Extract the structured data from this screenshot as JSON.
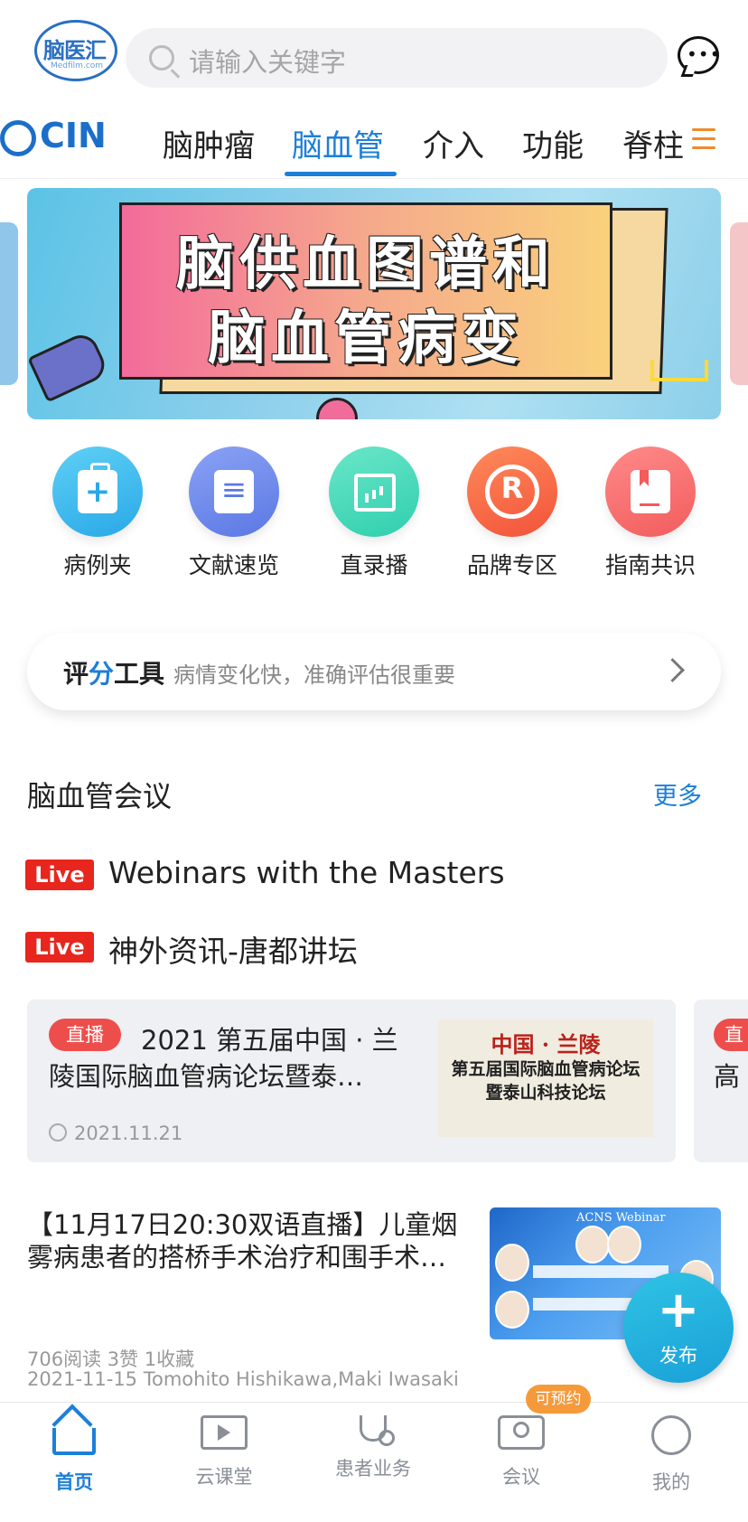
{
  "header": {
    "logo_text": "脑医汇",
    "logo_sub": "Medfilm.com",
    "search_placeholder": "请输入关键字"
  },
  "tabs": {
    "brand": "CIN",
    "items": [
      {
        "label": "脑肿瘤"
      },
      {
        "label": "脑血管",
        "active": true
      },
      {
        "label": "介入"
      },
      {
        "label": "功能"
      },
      {
        "label": "脊柱"
      }
    ]
  },
  "banner": {
    "line1": "脑供血图谱和",
    "line2": "脑血管病变"
  },
  "quick_actions": [
    {
      "label": "病例夹",
      "icon": "briefcase-plus-icon",
      "color": "#29a8e8"
    },
    {
      "label": "文献速览",
      "icon": "document-icon",
      "color": "#5b78e3"
    },
    {
      "label": "直录播",
      "icon": "chart-board-icon",
      "color": "#2fcfae"
    },
    {
      "label": "品牌专区",
      "icon": "registered-icon",
      "color": "#f2633a"
    },
    {
      "label": "指南共识",
      "icon": "bookmark-book-icon",
      "color": "#f25c5c"
    }
  ],
  "score_tool": {
    "title_a": "评",
    "title_b": "分",
    "title_c": "工具",
    "desc": "病情变化快，准确评估很重要"
  },
  "section": {
    "title": "脑血管会议",
    "more": "更多"
  },
  "live_items": [
    {
      "badge": "Live",
      "title": "Webinars with the Masters"
    },
    {
      "badge": "Live",
      "title": "神外资讯-唐都讲坛"
    }
  ],
  "meeting_cards": [
    {
      "badge": "直播",
      "title_line1": "2021 第五届中国 · 兰",
      "title_line2": "陵国际脑血管病论坛暨泰…",
      "date": "2021.11.21",
      "poster_line1": "中国 · 兰陵",
      "poster_line2": "第五届国际脑血管病论坛",
      "poster_line3": "暨泰山科技论坛"
    },
    {
      "badge": "直",
      "title_partial": "高"
    }
  ],
  "article": {
    "title_line1": "【11月17日20:30双语直播】儿童烟",
    "title_line2": "雾病患者的搭桥手术治疗和围手术…",
    "thumb_title": "ACNS Webinar",
    "stats": "706阅读 3赞 1收藏",
    "byline": "2021-11-15 Tomohito Hishikawa,Maki Iwasaki"
  },
  "fab": {
    "plus": "+",
    "label": "发布"
  },
  "bottom_nav": {
    "items": [
      {
        "label": "首页",
        "icon": "home-icon",
        "active": true
      },
      {
        "label": "云课堂",
        "icon": "video-play-icon"
      },
      {
        "label": "患者业务",
        "icon": "stethoscope-icon"
      },
      {
        "label": "会议",
        "icon": "meeting-icon"
      },
      {
        "label": "我的",
        "icon": "profile-icon"
      }
    ],
    "meeting_pill": "可预约"
  },
  "colors": {
    "accent": "#1c7fd9",
    "live_red": "#e8261e",
    "badge_red": "#ee4e4b",
    "pill_orange": "#f59a3b"
  }
}
